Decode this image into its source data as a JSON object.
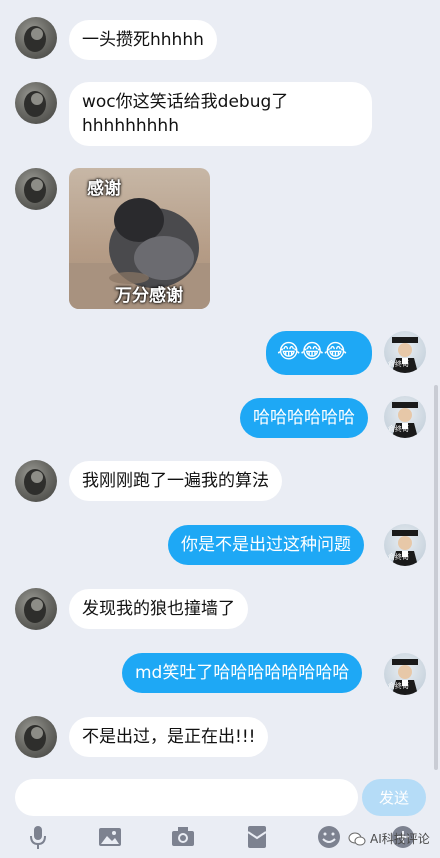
{
  "messages": [
    {
      "side": "left",
      "type": "text",
      "text": "一头攒死hhhhh"
    },
    {
      "side": "left",
      "type": "text",
      "text": "woc你这笑话给我debug了 hhhhhhhhh"
    },
    {
      "side": "left",
      "type": "sticker",
      "caption_top": "感谢",
      "caption_bottom": "万分感谢"
    },
    {
      "side": "right",
      "type": "emoji",
      "text": "😂😂😂"
    },
    {
      "side": "right",
      "type": "text",
      "text": "哈哈哈哈哈哈"
    },
    {
      "side": "left",
      "type": "text",
      "text": "我刚刚跑了一遍我的算法"
    },
    {
      "side": "right",
      "type": "text",
      "text": "你是不是出过这种问题"
    },
    {
      "side": "left",
      "type": "text",
      "text": "发现我的狼也撞墙了"
    },
    {
      "side": "right",
      "type": "text",
      "text": "md笑吐了哈哈哈哈哈哈哈哈"
    },
    {
      "side": "left",
      "type": "text",
      "text": "不是出过，是正在出!!!"
    }
  ],
  "my_avatar_caption": "俞终荀",
  "input": {
    "value": "",
    "placeholder": ""
  },
  "send_label": "发送",
  "toolbar_icons": [
    "microphone-icon",
    "image-icon",
    "camera-icon",
    "red-packet-icon",
    "emoji-icon",
    "plus-icon"
  ],
  "watermark": "AI科技评论",
  "colors": {
    "background": "#eaedf4",
    "my_bubble": "#1ea8f5",
    "their_bubble": "#ffffff",
    "send_button": "#b5dcf7"
  }
}
